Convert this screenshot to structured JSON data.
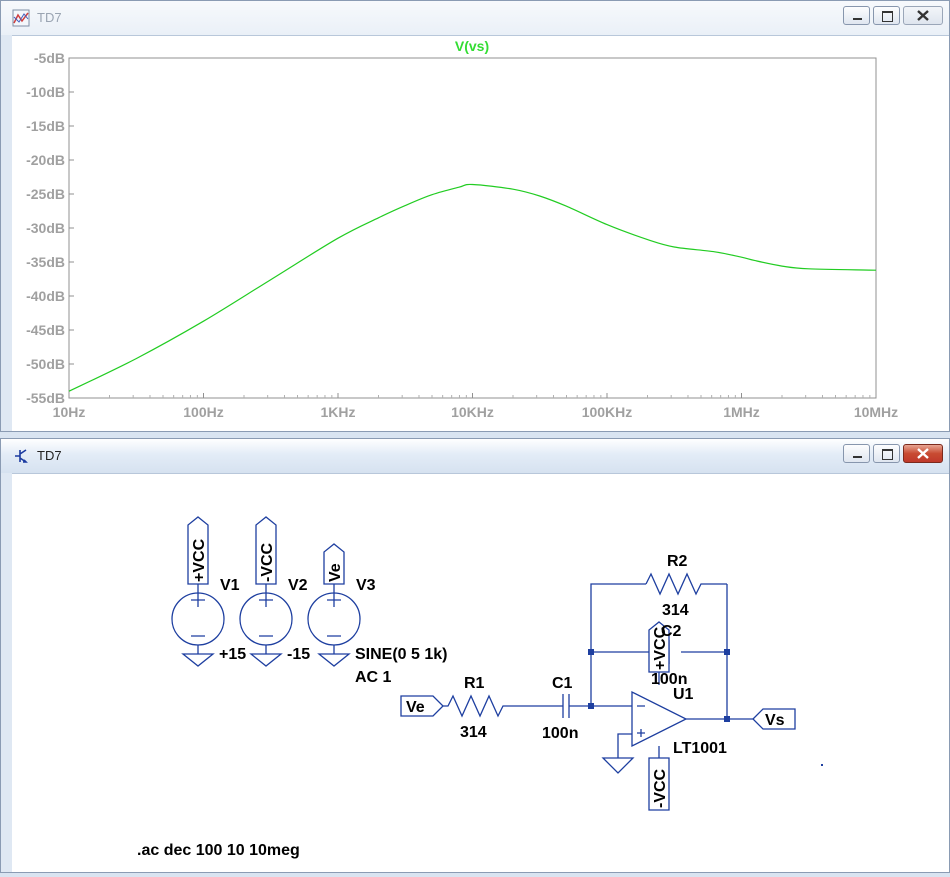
{
  "plot_window": {
    "title": "TD7",
    "trace_title": "V(vs)"
  },
  "schematic_window": {
    "title": "TD7",
    "labels": {
      "vcc_pos": "+VCC",
      "vcc_neg": "-VCC",
      "ve": "Ve",
      "vs": "Vs",
      "v1": "V1",
      "v2": "V2",
      "v3": "V3",
      "v1_value": "+15",
      "v2_value": "-15",
      "v3_value_line1": "SINE(0 5 1k)",
      "v3_value_line2": "AC 1",
      "r1": "R1",
      "r1_value": "314",
      "r2": "R2",
      "r2_value": "314",
      "c1": "C1",
      "c1_value": "100n",
      "c2": "C2",
      "c2_value": "100n",
      "u1": "U1",
      "u1_model": "LT1001",
      "opamp_vcc_pos": "+VCC",
      "opamp_vcc_neg": "-VCC",
      "directive": ".ac dec 100 10 10meg"
    }
  },
  "chart_data": {
    "type": "line",
    "title": "V(vs)",
    "xlabel": "",
    "ylabel": "",
    "x_scale": "log",
    "xlim": [
      10,
      10000000
    ],
    "ylim": [
      -55,
      -5
    ],
    "x_ticks": [
      "10Hz",
      "100Hz",
      "1KHz",
      "10KHz",
      "100KHz",
      "1MHz",
      "10MHz"
    ],
    "y_ticks": [
      "-5dB",
      "-10dB",
      "-15dB",
      "-20dB",
      "-25dB",
      "-30dB",
      "-35dB",
      "-40dB",
      "-45dB",
      "-50dB",
      "-55dB"
    ],
    "grid": false,
    "color": "#22cc22",
    "series": [
      {
        "name": "V(vs)",
        "x": [
          10,
          31.6,
          100,
          316,
          1000,
          2000,
          3160,
          5000,
          7940,
          10000,
          20000,
          31600,
          50000,
          100000,
          200000,
          316000,
          631000,
          1000000,
          1260000,
          2000000,
          3160000,
          10000000
        ],
        "y": [
          -54,
          -49.2,
          -43.7,
          -37.6,
          -31.5,
          -28.5,
          -26.7,
          -25.1,
          -24.0,
          -23.6,
          -24.3,
          -25.3,
          -26.8,
          -29.5,
          -31.7,
          -32.8,
          -33.5,
          -34.3,
          -34.8,
          -35.6,
          -36.0,
          -36.2
        ]
      }
    ]
  }
}
